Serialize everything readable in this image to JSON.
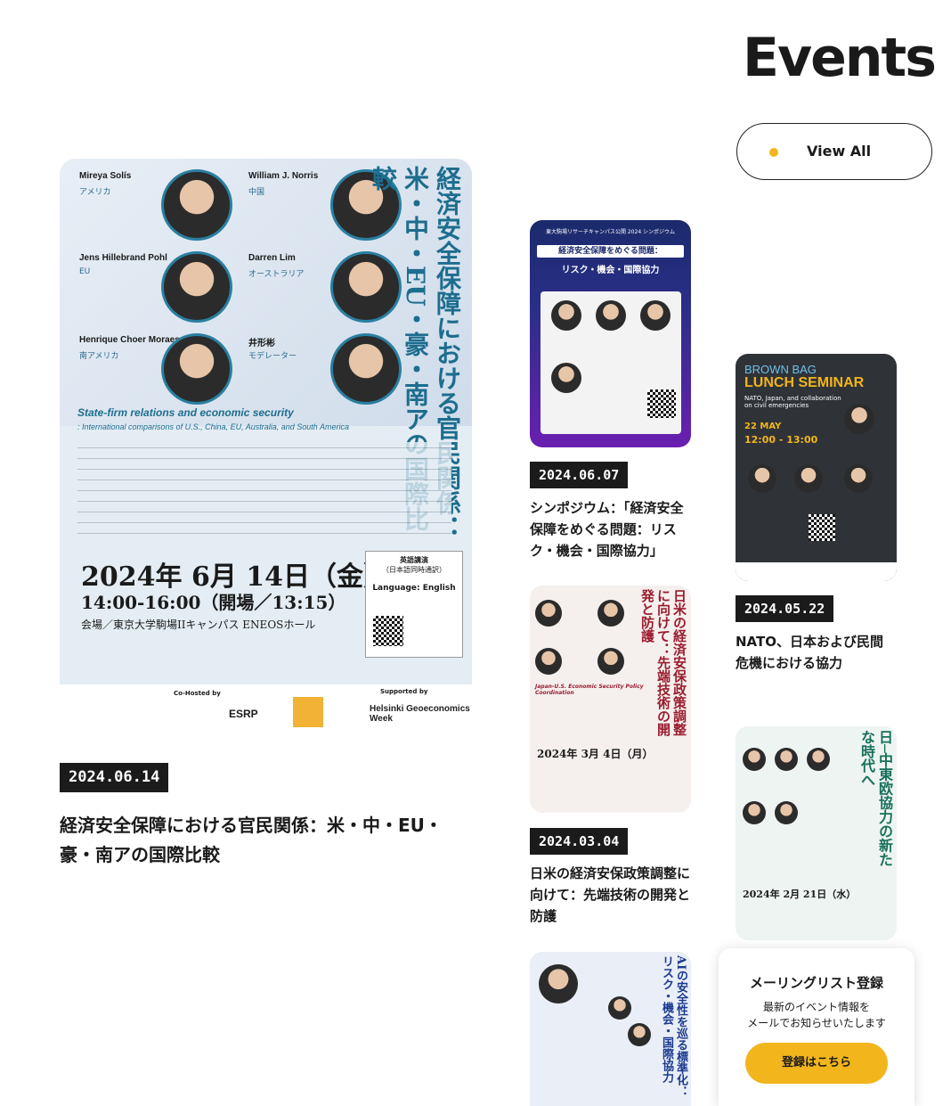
{
  "header": {
    "title": "Events",
    "view_all": "View All"
  },
  "events": [
    {
      "date": "2024.06.14",
      "title": "経済安全保障における官民関係：米・中・EU・豪・南アの国際比較",
      "poster": {
        "vertical_title": "経済安全保障における官民関係",
        "vertical_sub": "：米・中・EU・豪・南アの国際比較",
        "speakers": [
          {
            "name": "Mireya Solís",
            "region": "アメリカ"
          },
          {
            "name": "William J. Norris",
            "region": "中国"
          },
          {
            "name": "Jens Hillebrand Pohl",
            "region": "EU"
          },
          {
            "name": "Darren Lim",
            "region": "オーストラリア"
          },
          {
            "name": "Henrique Choer Moraes",
            "region": "南アメリカ"
          },
          {
            "name": "井形彬",
            "region": "モデレーター"
          }
        ],
        "en_title": "State-firm relations and economic security",
        "en_sub": ": International comparisons of U.S., China, EU, Australia, and South America",
        "date_text": "2024年 6月 14日（金）",
        "time_text": "14:00-16:00（開場／13:15）",
        "venue_text": "会場／東京大学駒場IIキャンパス ENEOSホール",
        "box_title": "英語講演",
        "box_sub": "（日本語同時通訳）",
        "box_lang": "Language: English",
        "co_hosted": "Co-Hosted by",
        "supported": "Supported by",
        "esrp": "ESRP",
        "helsinki": "Helsinki Geoeconomics Week"
      }
    },
    {
      "date": "2024.06.07",
      "title": "シンポジウム：「経済安全保障をめぐる問題：リスク・機会・国際協力」",
      "poster": {
        "head": "東大駒場リサーチキャンパス公開 2024 シンポジウム",
        "title": "経済安全保障をめぐる問題：",
        "sub": "リスク・機会・国際協力"
      }
    },
    {
      "date": "2024.05.22",
      "title": "NATO、日本および民間危機における協力",
      "poster": {
        "line1": "BROWN BAG",
        "line2": "LUNCH SEMINAR",
        "desc": "NATO, Japan, and collaboration on civil emergencies",
        "date": "22 MAY",
        "time": "12:00 - 13:00"
      }
    },
    {
      "date": "2024.03.04",
      "title": "日米の経済安保政策調整に向けて：先端技術の開発と防護",
      "poster": {
        "vertical": "日米の経済安保政策調整に向けて：先端技術の開発と防護",
        "en": "Japan-U.S. Economic Security Policy Coordination",
        "date_text": "2024年 3月 4日（月）"
      }
    },
    {
      "poster": {
        "vertical": "日─中東欧協力の新たな時代へ",
        "date_text": "2024年 2月 21日（水）"
      }
    },
    {
      "poster": {
        "vertical": "AIの安全性を巡る標準化：リスク・機会・国際協力"
      }
    }
  ],
  "mailing": {
    "title": "メーリングリスト登録",
    "line1": "最新のイベント情報を",
    "line2": "メールでお知らせいたします",
    "button": "登録はこちら"
  },
  "colors": {
    "accent": "#f2b51c",
    "badge": "#1b1b1b",
    "teal": "#1d6d8e"
  }
}
